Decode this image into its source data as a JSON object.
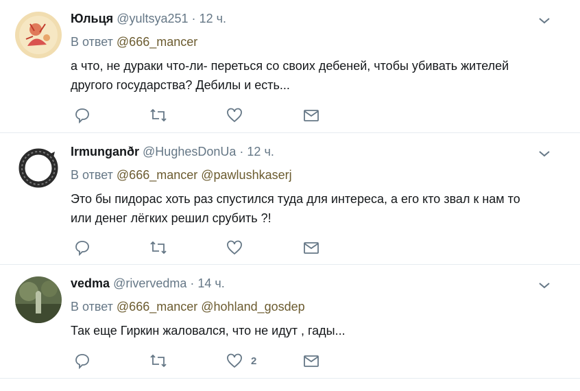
{
  "reply_prefix": "В ответ",
  "tweets": [
    {
      "name": "Юльця",
      "handle": "@yultsya251",
      "separator": "·",
      "time": "12 ч.",
      "reply_to": [
        "@666_mancer"
      ],
      "lines": [
        "а что, не дураки что-ли- переться со своих дебеней, чтобы убивать жителей",
        "другого государства? Дебилы и есть..."
      ],
      "like_count": ""
    },
    {
      "name": "Irmunganðr",
      "handle": "@HughesDonUa",
      "separator": "·",
      "time": "12 ч.",
      "reply_to": [
        "@666_mancer",
        "@pawlushkaserj"
      ],
      "lines": [
        "Это бы пидорас хоть раз спустился туда для интереса, а его кто звал к нам то",
        "или денег лёгких решил срубить ?!"
      ],
      "like_count": ""
    },
    {
      "name": "vedma",
      "handle": "@rivervedma",
      "separator": "·",
      "time": "14 ч.",
      "reply_to": [
        "@666_mancer",
        "@hohland_gosdep"
      ],
      "lines": [
        "Так еще Гиркин жаловался, что не идут , гады..."
      ],
      "like_count": "2"
    }
  ],
  "colors": {
    "text": "#14171a",
    "secondary": "#657786",
    "mention": "#6b5b2f",
    "divider": "#e6ecf0"
  }
}
